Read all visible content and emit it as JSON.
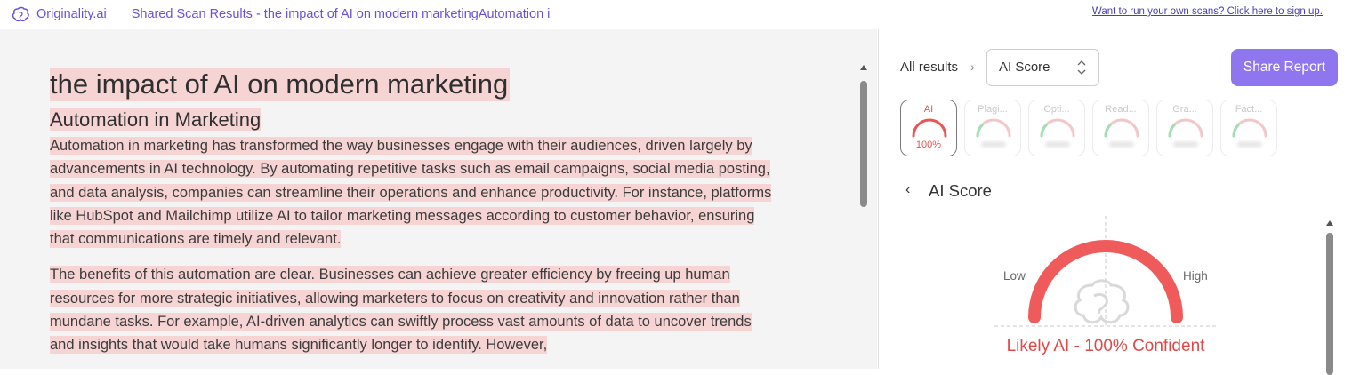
{
  "header": {
    "brand_icon": "brain-icon",
    "brand_name": "Originality.ai",
    "title": "Shared Scan Results - the impact of AI on modern marketingAutomation i",
    "signup_link": "Want to run your own scans? Click here to sign up."
  },
  "document": {
    "title": "the impact of AI on modern marketing",
    "subtitle": "Automation in Marketing",
    "paragraphs": [
      "Automation in marketing has transformed the way businesses engage with their audiences, driven largely by advancements in AI technology. By automating repetitive tasks such as email campaigns, social media posting, and data analysis, companies can streamline their operations and enhance productivity. For instance, platforms like HubSpot and Mailchimp utilize AI to tailor marketing messages according to customer behavior, ensuring that communications are timely and relevant.",
      "The benefits of this automation are clear. Businesses can achieve greater efficiency by freeing up human resources for more strategic initiatives, allowing marketers to focus on creativity and innovation rather than mundane tasks. For example, AI-driven analytics can swiftly process vast amounts of data to uncover trends and insights that would take humans significantly longer to identify. However,"
    ],
    "highlight_color": "#f7d4d4"
  },
  "results_panel": {
    "breadcrumb": "All results",
    "select": {
      "value": "AI Score"
    },
    "share_button": "Share Report",
    "accent_color": "#8f76ee",
    "tiles": [
      {
        "label": "AI",
        "value": "100%",
        "active": true,
        "gauge_color": "#e85555"
      },
      {
        "label": "Plagi...",
        "value": "",
        "active": false,
        "gauge_color": "#f5c6c6"
      },
      {
        "label": "Opti...",
        "value": "",
        "active": false,
        "gauge_color": "#f5c6c6"
      },
      {
        "label": "Read...",
        "value": "",
        "active": false,
        "gauge_color": "#f5c6c6"
      },
      {
        "label": "Gra...",
        "value": "",
        "active": false,
        "gauge_color": "#f5c6c6"
      },
      {
        "label": "Fact...",
        "value": "",
        "active": false,
        "gauge_color": "#f5c6c6"
      }
    ],
    "section_title": "AI Score",
    "gauge": {
      "low_label": "Low",
      "high_label": "High",
      "verdict": "Likely AI - 100% Confident",
      "score": 1.0,
      "color": "#ef5b5b"
    }
  }
}
